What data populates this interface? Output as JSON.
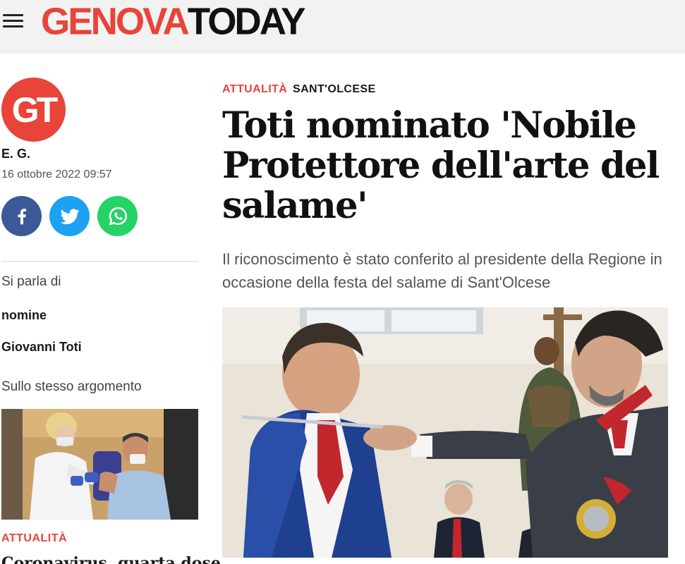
{
  "header": {
    "logo_part1": "GENOVA",
    "logo_part2": "TODAY"
  },
  "author": {
    "avatar_initials": "GT",
    "name": "E. G.",
    "date": "16 ottobre 2022 09:57"
  },
  "share": {
    "facebook": "facebook-icon",
    "twitter": "twitter-icon",
    "whatsapp": "whatsapp-icon"
  },
  "tags": {
    "label": "Si parla di",
    "items": [
      "nomine",
      "Giovanni Toti"
    ]
  },
  "related": {
    "label": "Sullo stesso argomento",
    "category": "ATTUALITÀ",
    "title": "Coronavirus, quarta dose"
  },
  "article": {
    "category": "ATTUALITÀ",
    "location": "SANT'OLCESE",
    "title": "Toti nominato 'Nobile Protettore dell'arte del salame'",
    "subtitle": "Il riconoscimento è stato conferito al presidente della Regione in occasione della festa del salame di Sant'Olcese"
  },
  "colors": {
    "brand_red": "#e8443a",
    "facebook": "#3b5998",
    "twitter": "#1da1f2",
    "whatsapp": "#25d366"
  }
}
